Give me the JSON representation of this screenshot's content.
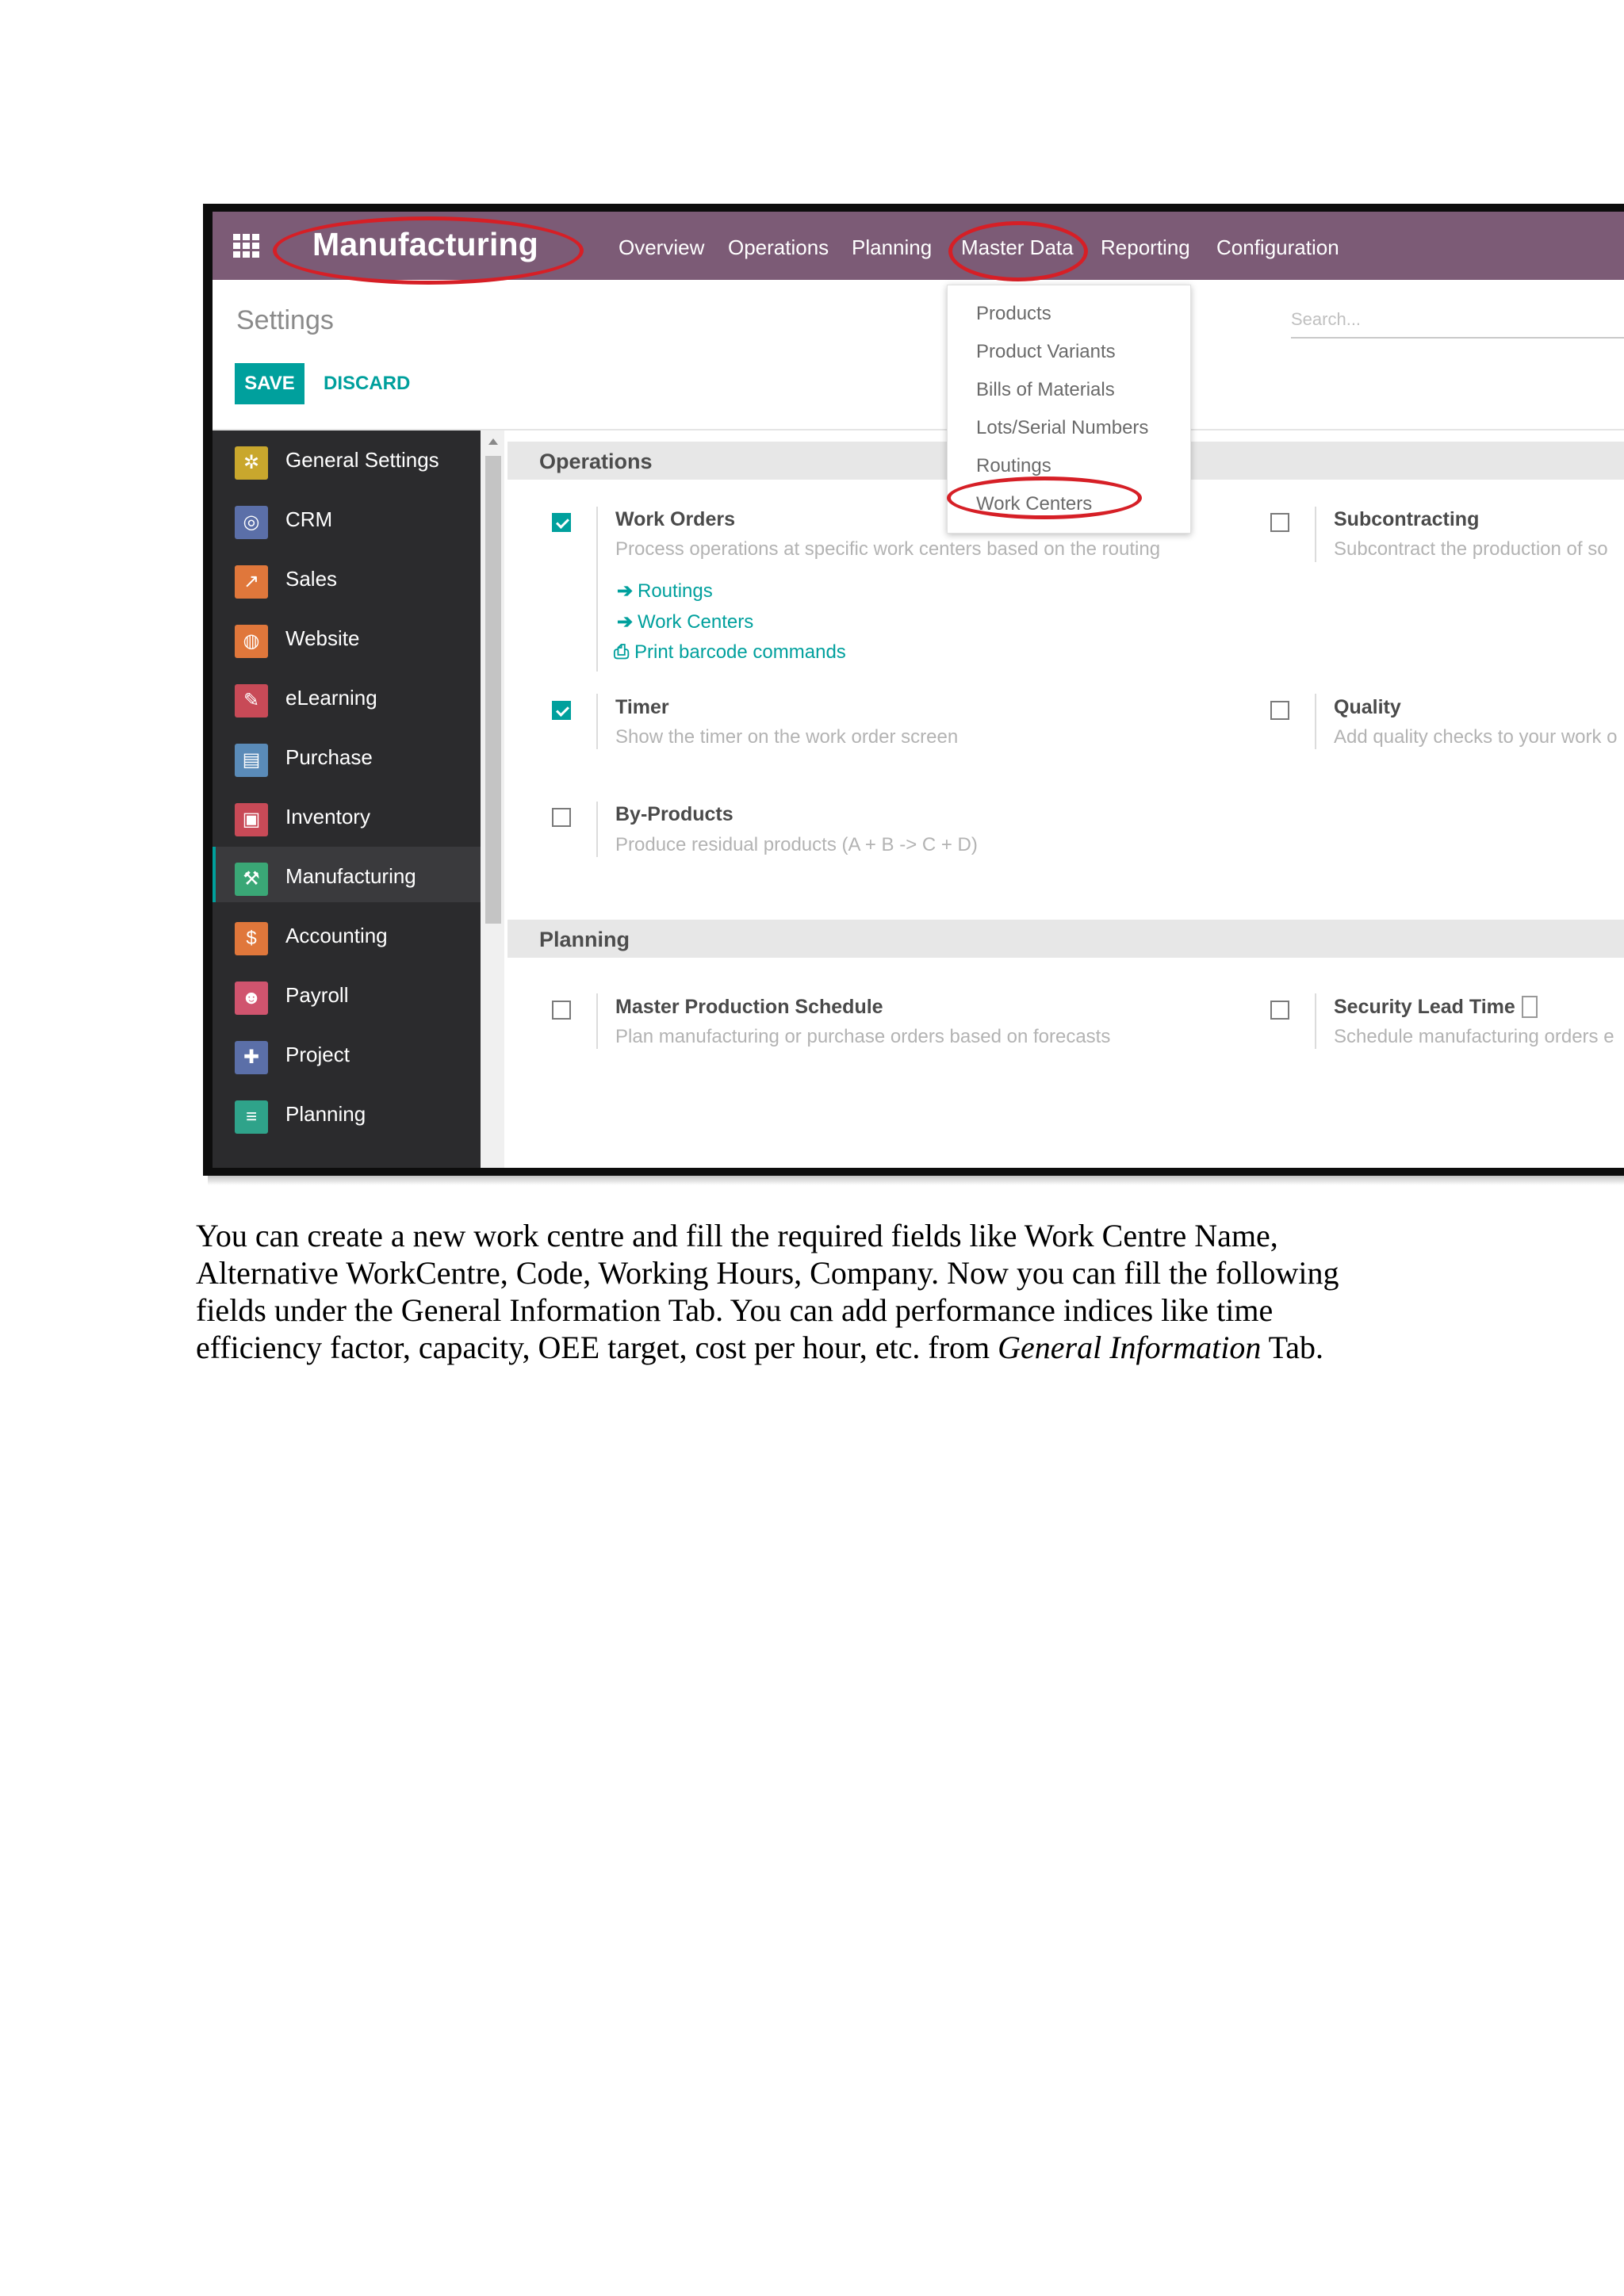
{
  "app": {
    "title": "Manufacturing",
    "nav": [
      "Overview",
      "Operations",
      "Planning",
      "Master Data",
      "Reporting",
      "Configuration"
    ]
  },
  "master_data_menu": [
    "Products",
    "Product Variants",
    "Bills of Materials",
    "Lots/Serial Numbers",
    "Routings",
    "Work Centers"
  ],
  "control_panel": {
    "title": "Settings",
    "save_label": "SAVE",
    "discard_label": "DISCARD",
    "search_placeholder": "Search..."
  },
  "sidebar": {
    "items": [
      {
        "label": "General Settings",
        "icon": "gear-icon",
        "color": "#c9a72d"
      },
      {
        "label": "CRM",
        "icon": "handshake-icon",
        "color": "#5b6fa8"
      },
      {
        "label": "Sales",
        "icon": "chart-icon",
        "color": "#e0773b"
      },
      {
        "label": "Website",
        "icon": "globe-icon",
        "color": "#e0773b"
      },
      {
        "label": "eLearning",
        "icon": "elearning-icon",
        "color": "#c84a57"
      },
      {
        "label": "Purchase",
        "icon": "purchase-icon",
        "color": "#5a8bb8"
      },
      {
        "label": "Inventory",
        "icon": "box-icon",
        "color": "#c84a57"
      },
      {
        "label": "Manufacturing",
        "icon": "wrench-icon",
        "color": "#3aa776"
      },
      {
        "label": "Accounting",
        "icon": "accounting-icon",
        "color": "#e0773b"
      },
      {
        "label": "Payroll",
        "icon": "payroll-icon",
        "color": "#d0546e"
      },
      {
        "label": "Project",
        "icon": "puzzle-icon",
        "color": "#5b6fa8"
      },
      {
        "label": "Planning",
        "icon": "planning-icon",
        "color": "#2fa38a"
      }
    ]
  },
  "sections": {
    "operations": {
      "title": "Operations",
      "work_orders": {
        "title": "Work Orders",
        "desc": "Process operations at specific work centers based on the routing",
        "checked": true,
        "links": [
          "Routings",
          "Work Centers",
          "Print barcode commands"
        ]
      },
      "subcontracting": {
        "title": "Subcontracting",
        "desc": "Subcontract the production of so",
        "checked": false
      },
      "timer": {
        "title": "Timer",
        "desc": "Show the timer on the work order screen",
        "checked": true
      },
      "quality": {
        "title": "Quality",
        "desc": "Add quality checks to your work o",
        "checked": false
      },
      "by_products": {
        "title": "By-Products",
        "desc": "Produce residual products (A + B -> C + D)",
        "checked": false
      }
    },
    "planning": {
      "title": "Planning",
      "mps": {
        "title": "Master Production Schedule",
        "desc": "Plan manufacturing or purchase orders based on forecasts",
        "checked": false
      },
      "security_lead_time": {
        "title": "Security Lead Time",
        "desc": "Schedule manufacturing orders e",
        "checked": false
      }
    }
  },
  "paragraph": {
    "line1": "You can create a new work centre and fill the required fields like Work Centre Name,",
    "line2": "Alternative WorkCentre, Code, Working Hours, Company. Now you can fill the following",
    "line3": "fields under the General Information Tab. You can add performance indices like time",
    "line4_start": "efficiency factor, capacity, OEE target, cost per hour, etc. from ",
    "line4_italic": "General Information",
    "line4_end": " Tab."
  },
  "colors": {
    "navbar": "#7c5b76",
    "accent": "#00a09d",
    "sidebar": "#2b2b2d",
    "highlight_circle": "#d61f26"
  }
}
